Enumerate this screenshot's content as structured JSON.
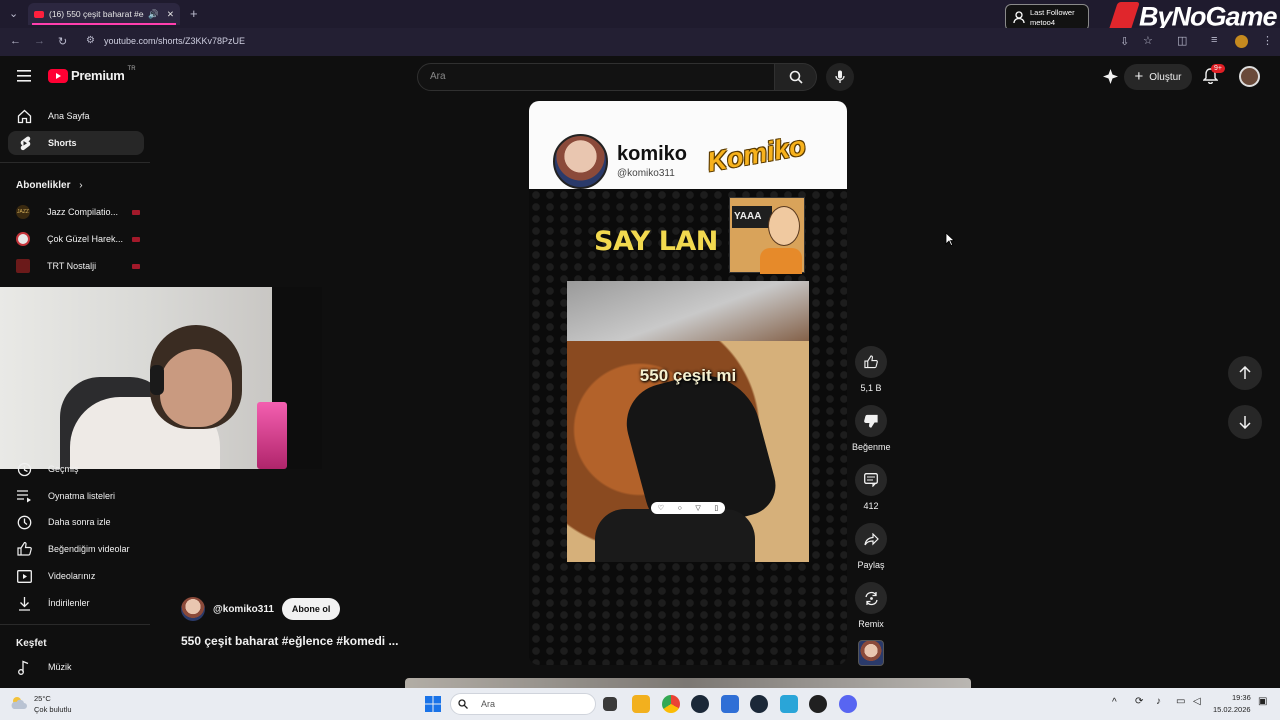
{
  "browser": {
    "tab_title": "(16) 550 çeşit baharat #eğle",
    "url": "youtube.com/shorts/Z3KKv78PzUE"
  },
  "overlay": {
    "follower_title": "Last Follower",
    "follower_name": "metoo4",
    "brand": "ByNoGame"
  },
  "header": {
    "logo_text": "Premium",
    "country": "TR",
    "search_placeholder": "Ara",
    "create_label": "Oluştur",
    "notification_badge": "9+"
  },
  "sidebar": {
    "main_items": [
      {
        "label": "Ana Sayfa",
        "icon": "home-icon"
      },
      {
        "label": "Shorts",
        "icon": "shorts-icon"
      }
    ],
    "subscriptions_title": "Abonelikler",
    "subscriptions": [
      {
        "label": "Jazz Compilatio...",
        "avatar_color": "#3a2a10"
      },
      {
        "label": "Çok Güzel Harek...",
        "avatar_color": "#e8e8e8"
      },
      {
        "label": "TRT Nostalji",
        "avatar_color": "#6b1a1a"
      }
    ],
    "you_items": [
      {
        "label": "Geçmiş",
        "icon": "history-icon"
      },
      {
        "label": "Oynatma listeleri",
        "icon": "playlist-icon"
      },
      {
        "label": "Daha sonra izle",
        "icon": "clock-icon"
      },
      {
        "label": "Beğendiğim videolar",
        "icon": "thumbs-up-icon"
      },
      {
        "label": "Videolarınız",
        "icon": "video-icon"
      },
      {
        "label": "İndirilenler",
        "icon": "download-icon"
      }
    ],
    "explore_title": "Keşfet",
    "explore_items": [
      {
        "label": "Müzik",
        "icon": "music-icon"
      }
    ]
  },
  "short": {
    "channel_name": "komiko",
    "channel_handle": "@komiko311",
    "logo_text": "Komiko",
    "meme_text": "SAY LAN",
    "sign_text": "YAAA",
    "caption": "550 çeşit mi"
  },
  "actions": {
    "likes": "5,1 B",
    "dislike_label": "Beğenme",
    "comments": "412",
    "share_label": "Paylaş",
    "remix_label": "Remix"
  },
  "video_info": {
    "channel": "@komiko311",
    "subscribe_label": "Abone ol",
    "title": "550 çeşit baharat #eğlence #komedi ..."
  },
  "taskbar": {
    "weather_temp": "25°C",
    "weather_desc": "Çok bulutlu",
    "search_placeholder": "Ara",
    "time": "19:36",
    "date": "15.02.2026"
  }
}
